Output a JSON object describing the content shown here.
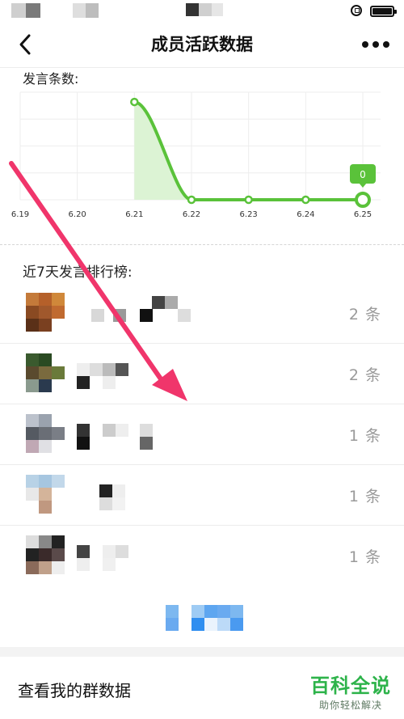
{
  "nav": {
    "title": "成员活跃数据"
  },
  "chart_section": {
    "label": "发言条数:"
  },
  "chart_data": {
    "type": "line",
    "x": [
      "6.19",
      "6.20",
      "6.21",
      "6.22",
      "6.23",
      "6.24",
      "6.25"
    ],
    "series": [
      {
        "values": [
          null,
          null,
          3,
          0,
          0,
          0,
          0
        ]
      }
    ],
    "highlighted_point": {
      "x": "6.25",
      "label": "0"
    },
    "ylim": [
      0,
      3.3
    ],
    "grid": true,
    "colors": {
      "line": "#5ac23a",
      "area": "#dcf3d4",
      "badge": "#5ac23a"
    }
  },
  "ranking": {
    "title": "近7天发言排行榜:",
    "rows": [
      {
        "count": "2 条"
      },
      {
        "count": "2 条"
      },
      {
        "count": "1 条"
      },
      {
        "count": "1 条"
      },
      {
        "count": "1 条"
      }
    ]
  },
  "bottom_link": {
    "label": "查看我的群数据"
  },
  "watermark": {
    "main": "百科全说",
    "sub": "助你轻松解决"
  },
  "colors": {
    "accent": "#5ac23a",
    "arrow": "#f0356b",
    "watermark": "#2db34a"
  }
}
